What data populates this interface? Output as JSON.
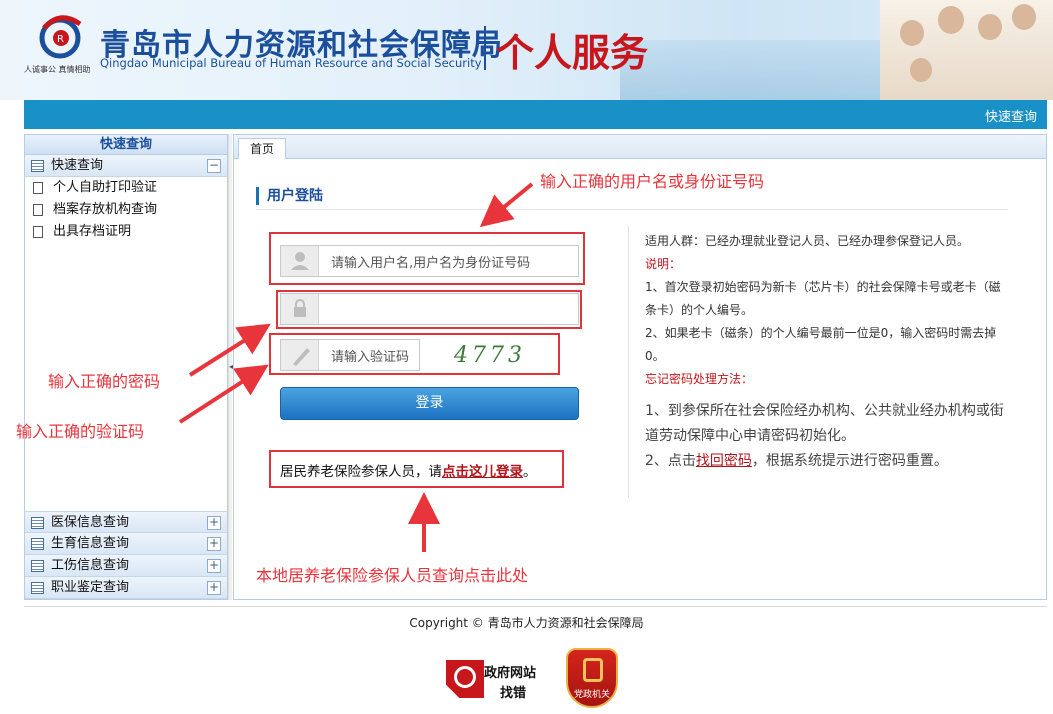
{
  "header": {
    "logo_slogan": "人诚事公 真情相助",
    "title_cn": "青岛市人力资源和社会保障局",
    "title_en": "Qingdao Municipal Bureau of Human Resource and Social Security",
    "service": "个人服务"
  },
  "navbar": {
    "quick_query": "快速查询"
  },
  "sidebar": {
    "title": "快速查询",
    "group_open": {
      "label": "快速查询",
      "toggle": "−"
    },
    "items": [
      {
        "label": "个人自助打印验证"
      },
      {
        "label": "档案存放机构查询"
      },
      {
        "label": "出具存档证明"
      }
    ],
    "groups": [
      {
        "label": "医保信息查询",
        "toggle": "+"
      },
      {
        "label": "生育信息查询",
        "toggle": "+"
      },
      {
        "label": "工伤信息查询",
        "toggle": "+"
      },
      {
        "label": "职业鉴定查询",
        "toggle": "+"
      }
    ]
  },
  "tabs": [
    {
      "label": "首页"
    }
  ],
  "login": {
    "title": "用户登陆",
    "username_placeholder": "请输入用户名,用户名为身份证号码",
    "password_placeholder": "",
    "captcha_placeholder": "请输入验证码",
    "captcha_code": "4773",
    "button": "登录",
    "resident_prefix": "居民养老保险参保人员，请",
    "resident_link": "点击这儿登录",
    "resident_suffix": "。"
  },
  "info": {
    "applicable": "适用人群：已经办理就业登记人员、已经办理参保登记人员。",
    "note_title": "说明：",
    "note1": "1、首次登录初始密码为新卡（芯片卡）的社会保障卡号或老卡（磁条卡）的个人编号。",
    "note2": "2、如果老卡（磁条）的个人编号最前一位是0，输入密码时需去掉0。",
    "forgot_title": "忘记密码处理方法：",
    "forgot1": "1、到参保所在社会保险经办机构、公共就业经办机构或街道劳动保障中心申请密码初始化。",
    "forgot2_prefix": "2、点击",
    "forgot2_link": "找回密码",
    "forgot2_suffix": "，根据系统提示进行密码重置。"
  },
  "annotations": {
    "username": "输入正确的用户名或身份证号码",
    "password": "输入正确的密码",
    "captcha": "输入正确的验证码",
    "resident": "本地居养老保险参保人员查询点击此处"
  },
  "footer": {
    "copyright": "Copyright © 青岛市人力资源和社会保障局",
    "gov_site_line1": "政府网站",
    "gov_site_line2": "找错",
    "badge_text": "党政机关"
  },
  "colors": {
    "navbar": "#1a91c6",
    "title_blue": "#1b4f9c",
    "accent_red": "#c8161d",
    "annotation_red": "#e8353c"
  }
}
